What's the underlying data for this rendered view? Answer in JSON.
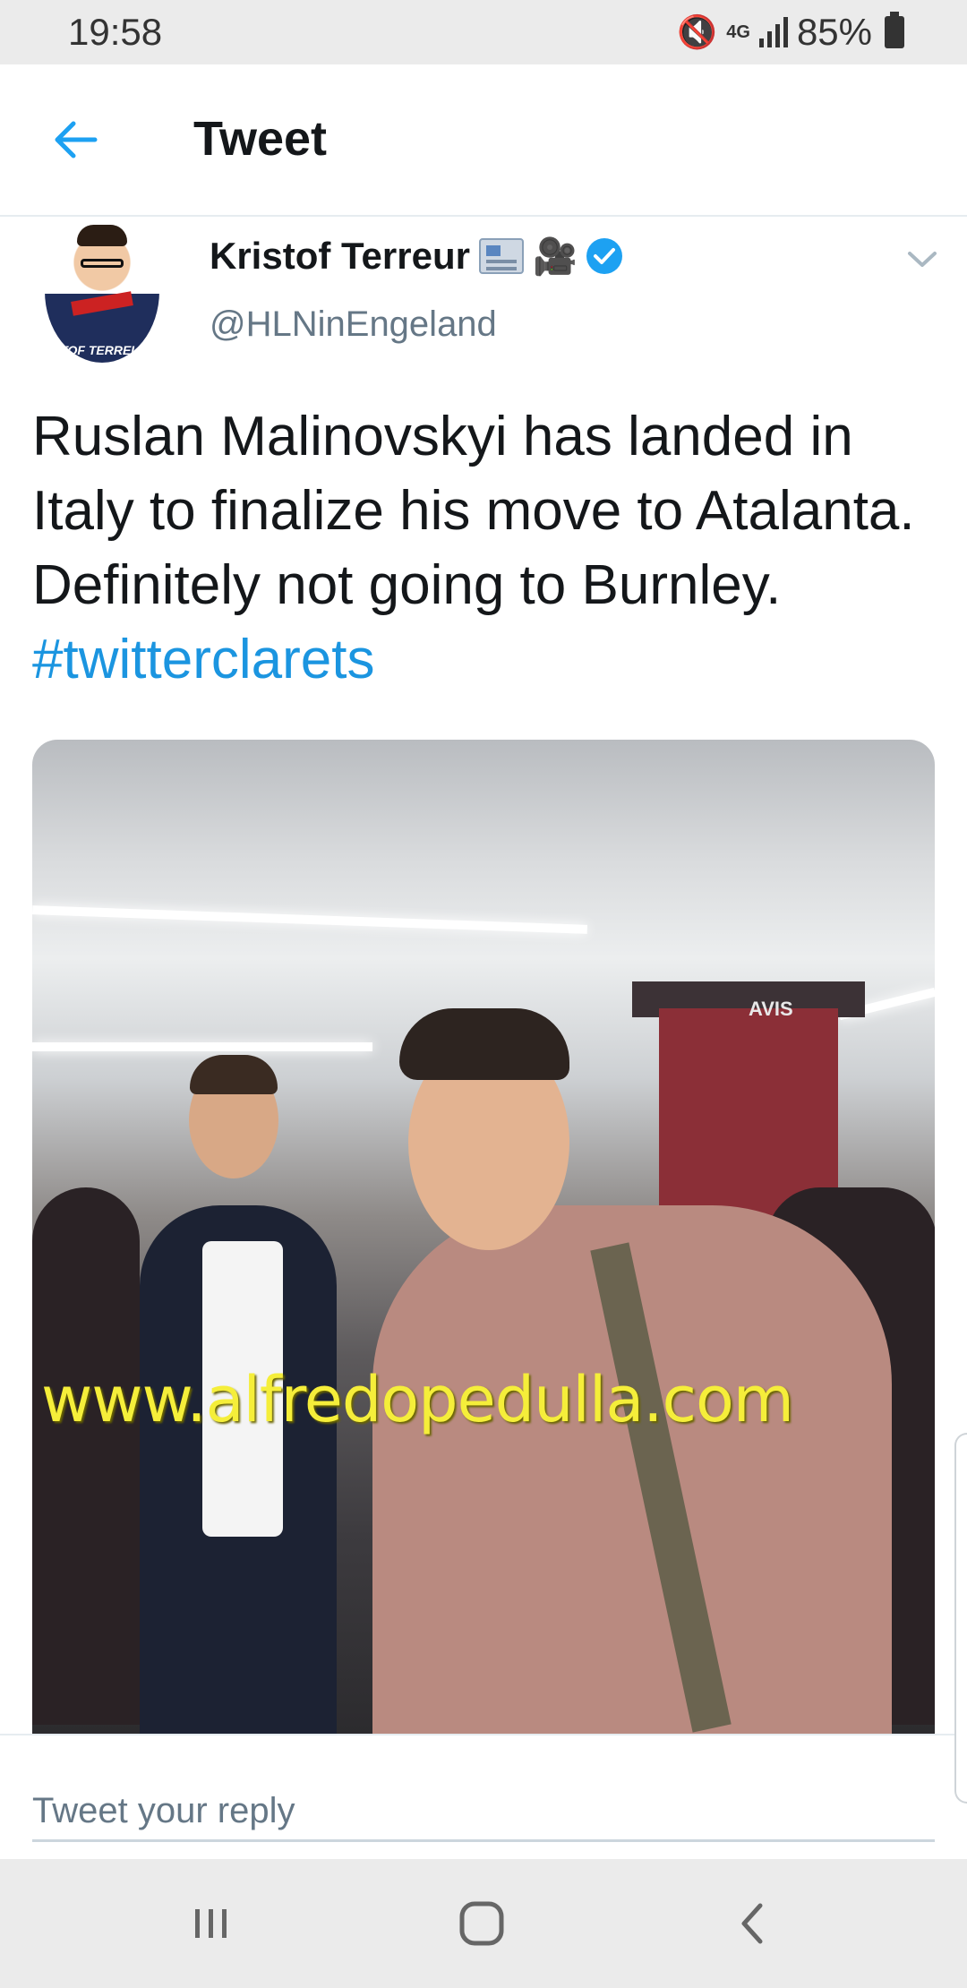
{
  "status_bar": {
    "time": "19:58",
    "network": "4G",
    "battery": "85%"
  },
  "app_bar": {
    "title": "Tweet"
  },
  "tweet": {
    "author": {
      "display_name": "Kristof Terreur",
      "handle": "@HLNinEngeland",
      "avatar_caption": "ISTOF TERREU",
      "emojis": [
        "newspaper-icon",
        "movie-camera-icon"
      ],
      "verified": true
    },
    "text_plain": "Ruslan Malinovskyi has landed in Italy to finalize his move to Atalanta. Definitely not going to Burnley.",
    "hashtag": "#twitterclarets",
    "media": {
      "watermark": "www.alfredopedulla.com",
      "sign_text": "AVIS"
    }
  },
  "reply": {
    "placeholder": "Tweet your reply"
  },
  "colors": {
    "link": "#1b95e0",
    "verified": "#1da1f2",
    "secondary_text": "#657786"
  }
}
